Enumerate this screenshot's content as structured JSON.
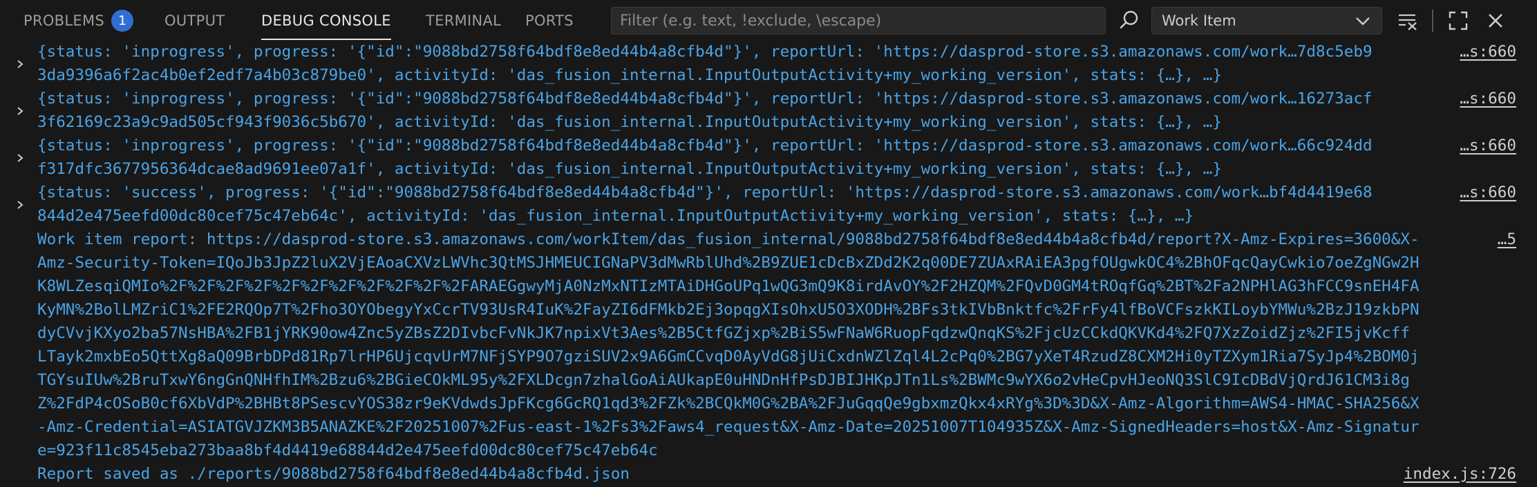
{
  "panel": {
    "tabs": [
      {
        "label": "PROBLEMS",
        "badge": "1"
      },
      {
        "label": "OUTPUT"
      },
      {
        "label": "DEBUG CONSOLE"
      },
      {
        "label": "TERMINAL"
      },
      {
        "label": "PORTS"
      }
    ],
    "filter_placeholder": "Filter (e.g. text, !exclude, \\escape)",
    "selected_session": "Work Item",
    "icons": [
      "search-icon",
      "chevron-down-icon",
      "clear-console-icon",
      "maximize-icon",
      "close-icon"
    ]
  },
  "console": {
    "entries": [
      {
        "line1": "{status: 'inprogress', progress: '{\"id\":\"9088bd2758f64bdf8e8ed44b4a8cfb4d\"}', reportUrl: 'https://dasprod-store.s3.amazonaws.com/work…7d8c5eb9",
        "line2": "3da9396a6f2ac4b0ef2edf7a4b03c879be0', activityId: 'das_fusion_internal.InputOutputActivity+my_working_version', stats: {…}, …}",
        "source": "…s:660"
      },
      {
        "line1": "{status: 'inprogress', progress: '{\"id\":\"9088bd2758f64bdf8e8ed44b4a8cfb4d\"}', reportUrl: 'https://dasprod-store.s3.amazonaws.com/work…16273acf",
        "line2": "3f62169c23a9c9ad505cf943f9036c5b670', activityId: 'das_fusion_internal.InputOutputActivity+my_working_version', stats: {…}, …}",
        "source": "…s:660"
      },
      {
        "line1": "{status: 'inprogress', progress: '{\"id\":\"9088bd2758f64bdf8e8ed44b4a8cfb4d\"}', reportUrl: 'https://dasprod-store.s3.amazonaws.com/work…66c924dd",
        "line2": "f317dfc3677956364dcae8ad9691ee07a1f', activityId: 'das_fusion_internal.InputOutputActivity+my_working_version', stats: {…}, …}",
        "source": "…s:660"
      },
      {
        "line1": "{status: 'success', progress: '{\"id\":\"9088bd2758f64bdf8e8ed44b4a8cfb4d\"}', reportUrl: 'https://dasprod-store.s3.amazonaws.com/work…bf4d4419e68",
        "line2": "844d2e475eefd00dc80cef75c47eb64c', activityId: 'das_fusion_internal.InputOutputActivity+my_working_version', stats: {…}, …}",
        "source": "…s:660"
      }
    ],
    "report_lines": [
      "Work item report: https://dasprod-store.s3.amazonaws.com/workItem/das_fusion_internal/9088bd2758f64bdf8e8ed44b4a8cfb4d/report?X-Amz-Expires=3600&X-",
      "Amz-Security-Token=IQoJb3JpZ2luX2VjEAoaCXVzLWVhc3QtMSJHMEUCIGNaPV3dMwRblUhd%2B9ZUE1cDcBxZDd2K2q00DE7ZUAxRAiEA3pgfOUgwkOC4%2BhOFqcQayCwkio7oeZgNGw2H",
      "K8WLZesqiQMIo%2F%2F%2F%2F%2F%2F%2F%2F%2F%2F%2FARAEGgwyMjA0NzMxNTIzMTAiDHGoUPq1wQG3mQ9K8irdAvOY%2F2HZQM%2FQvD0GM4tROqfGq%2BT%2Fa2NPHlAG3hFCC9snEH4FA",
      "KyMN%2BolLMZriC1%2FE2RQOp7T%2Fho3OYObegyYxCcrTV93UsR4IuK%2FayZI6dFMkb2Ej3opqgXIsOhxU5O3XODH%2BFs3tkIVbBnktfc%2FrFy4lfBoVCFszkKILoybYMWu%2BzJ19zkbPN",
      "dyCVvjKXyo2ba57NsHBA%2FB1jYRK90ow4Znc5yZBsZ2DIvbcFvNkJK7npixVt3Aes%2B5CtfGZjxp%2BiS5wFNaW6RuopFqdzwQnqKS%2FjcUzCCkdQKVKd4%2FQ7XzZoidZjz%2FI5jvKcff",
      "LTayk2mxbEo5QttXg8aQ09BrbDPd81Rp7lrHP6UjcqvUrM7NFjSYP9O7gziSUV2x9A6GmCCvqD0AyVdG8jUiCxdnWZlZql4L2cPq0%2BG7yXeT4RzudZ8CXM2Hi0yTZXym1Ria7SyJp4%2BOM0j",
      "TGYsuIUw%2BruTxwY6ngGnQNHfhIM%2Bzu6%2BGieCOkML95y%2FXLDcgn7zhalGoAiAUkapE0uHNDnHfPsDJBIJHKpJTn1Ls%2BWMc9wYX6o2vHeCpvHJeoNQ3SlC9IcDBdVjQrdJ61CM3i8g",
      "Z%2FdP4cOSoB0cf6XbVdP%2BHBt8PSescvYOS38zr9eKVdwdsJpFKcg6GcRQ1qd3%2FZk%2BCQkM0G%2BA%2FJuGqqQe9gbxmzQkx4xRYg%3D%3D&X-Amz-Algorithm=AWS4-HMAC-SHA256&X",
      "-Amz-Credential=ASIATGVJZKM3B5ANAZKE%2F20251007%2Fus-east-1%2Fs3%2Faws4_request&X-Amz-Date=20251007T104935Z&X-Amz-SignedHeaders=host&X-Amz-Signatur",
      "e=923f11c8545eba273baa8bf4d4419e68844d2e475eefd00dc80cef75c47eb64c"
    ],
    "report_source": "…5",
    "saved_line": "Report saved as ./reports/9088bd2758f64bdf8e8ed44b4a8cfb4d.json",
    "saved_source": "index.js:726"
  }
}
